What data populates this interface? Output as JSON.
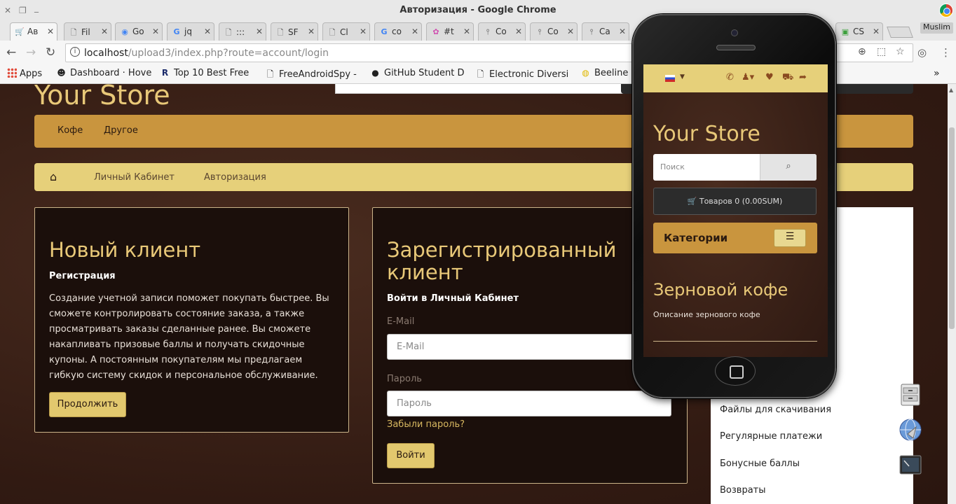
{
  "window": {
    "title": "Авторизация - Google Chrome",
    "profile": "Muslim"
  },
  "tabs": [
    {
      "label": "Ав",
      "favicon": "shopping-cart-icon"
    },
    {
      "label": "Fil",
      "favicon": "document-icon"
    },
    {
      "label": "Go",
      "favicon": "chrome-icon"
    },
    {
      "label": "jq",
      "favicon": "google-icon"
    },
    {
      "label": ":::",
      "favicon": "document-icon"
    },
    {
      "label": "SF",
      "favicon": "document-icon"
    },
    {
      "label": "Cl",
      "favicon": "document-icon"
    },
    {
      "label": "co",
      "favicon": "google-icon"
    },
    {
      "label": "#t",
      "favicon": "color-wheel-icon"
    },
    {
      "label": "Co",
      "favicon": "pin-icon"
    },
    {
      "label": "Co",
      "favicon": "pin-icon"
    },
    {
      "label": "Ca",
      "favicon": "pin-icon"
    },
    {
      "label": "CS",
      "favicon": "css3-icon"
    }
  ],
  "address": {
    "host": "localhost",
    "path": "/upload3/index.php?route=account/login"
  },
  "bookmarks": [
    {
      "label": "Apps"
    },
    {
      "label": "Dashboard · Hove"
    },
    {
      "label": "Top 10 Best Free"
    },
    {
      "label": "FreeAndroidSpy -"
    },
    {
      "label": "GitHub Student D"
    },
    {
      "label": "Electronic Diversi"
    },
    {
      "label": "Beeline"
    }
  ],
  "store": {
    "name": "Your Store",
    "menu": [
      "Кофе",
      "Другое"
    ],
    "breadcrumb": [
      "Личный Кабинет",
      "Авторизация"
    ]
  },
  "new_customer": {
    "title": "Новый клиент",
    "subtitle": "Регистрация",
    "text": "Создание учетной записи поможет покупать быстрее. Вы сможете контролировать состояние заказа, а также просматривать заказы сделанные ранее. Вы сможете накапливать призовые баллы и получать скидочные купоны. А постоянным покупателям мы предлагаем гибкую систему скидок и персональное обслуживание.",
    "button": "Продолжить"
  },
  "returning_customer": {
    "title": "Зарегистрированный клиент",
    "subtitle": "Войти в Личный Кабинет",
    "email_label": "E-Mail",
    "email_placeholder": "E-Mail",
    "password_label": "Пароль",
    "password_placeholder": "Пароль",
    "forgot": "Забыли пароль?",
    "button": "Войти"
  },
  "sidebar": [
    "Файлы для скачивания",
    "Регулярные платежи",
    "Бонусные баллы",
    "Возвраты"
  ],
  "phone": {
    "store_name": "Your Store",
    "search_placeholder": "Поиск",
    "cart": "Товаров 0 (0.00SUM)",
    "categories_label": "Категории",
    "category_title": "Зерновой кофе",
    "category_desc": "Описание зернового кофе"
  },
  "colors": {
    "accent_gold": "#c9953e",
    "breadcrumb_bg": "#e6d07a",
    "panel_bg": "#1b0f0b",
    "heading": "#e8c878"
  }
}
